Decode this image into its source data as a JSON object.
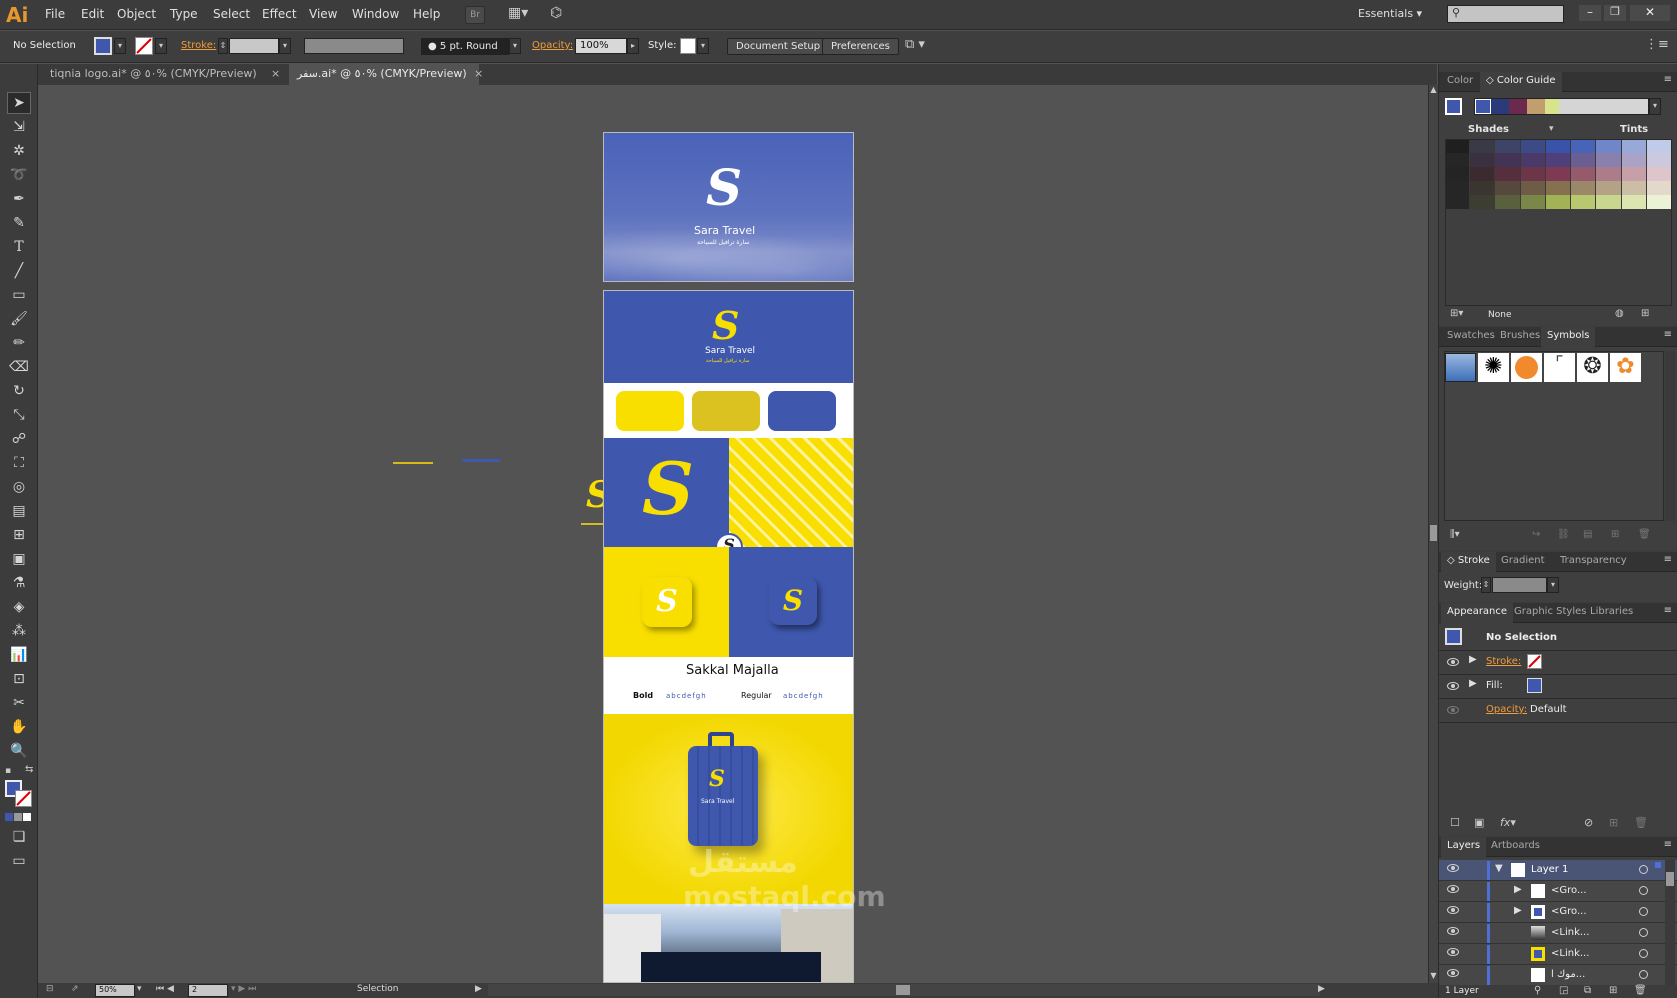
{
  "app": {
    "logo": "Ai",
    "menus": [
      "File",
      "Edit",
      "Object",
      "Type",
      "Select",
      "Effect",
      "View",
      "Window",
      "Help"
    ],
    "bridge_btn": "Br",
    "workspace": "Essentials",
    "search_placeholder": ""
  },
  "control": {
    "selection_label": "No Selection",
    "stroke_label": "Stroke:",
    "brush": "5 pt. Round",
    "opacity_label": "Opacity:",
    "opacity_value": "100%",
    "style_label": "Style:",
    "doc_setup": "Document Setup",
    "preferences": "Preferences"
  },
  "tabs": [
    {
      "label": "tiqnia logo.ai* @ ٥٠% (CMYK/Preview)",
      "close": "×"
    },
    {
      "label": "سفر.ai* @ ٥٠% (CMYK/Preview)",
      "close": "×"
    }
  ],
  "artboards": {
    "brand": "Sara Travel",
    "brand_arabic": "سارة ترافيل للسياحة",
    "font_name": "Sakkal Majalla",
    "bold_label": "Bold",
    "regular_label": "Regular",
    "sample_text": "abcdefgh",
    "colors": [
      "#f8df00",
      "#dcc221",
      "#3f58ae"
    ]
  },
  "status": {
    "zoom": "50%",
    "page": "2",
    "tool": "Selection"
  },
  "color_panel": {
    "tabs": [
      "Color",
      "Color Guide"
    ],
    "shades": "Shades",
    "tints": "Tints",
    "none": "None",
    "rows": [
      [
        "#1f1f1f",
        "#3a3a46",
        "#3e4466",
        "#3c4a86",
        "#3953a8",
        "#4864b9",
        "#6f86c9",
        "#97a8d9",
        "#bfcbe9"
      ],
      [
        "#262626",
        "#3a3040",
        "#433456",
        "#4a3a6a",
        "#4f3f7a",
        "#6a5e93",
        "#8a80ad",
        "#aaa3c6",
        "#ccc8de"
      ],
      [
        "#242424",
        "#3b2a30",
        "#55303c",
        "#6d3648",
        "#7d3a52",
        "#955a6c",
        "#ad7c8a",
        "#c69fa9",
        "#dec4cb"
      ],
      [
        "#262626",
        "#3b3530",
        "#56483c",
        "#6f5c48",
        "#85704f",
        "#9b8868",
        "#b3a285",
        "#cbbda6",
        "#e2d9cb"
      ],
      [
        "#262626",
        "#3b3e31",
        "#58603d",
        "#7b8649",
        "#a1b355",
        "#b7c86f",
        "#c9d78e",
        "#dae5b0",
        "#ebf2d6"
      ]
    ]
  },
  "symbols_panel": {
    "tabs": [
      "Swatches",
      "Brushes",
      "Symbols"
    ]
  },
  "stroke_panel": {
    "tabs": [
      "Stroke",
      "Gradient",
      "Transparency"
    ],
    "weight_label": "Weight:"
  },
  "appearance_panel": {
    "tabs": [
      "Appearance",
      "Graphic Styles",
      "Libraries"
    ],
    "title": "No Selection",
    "stroke_label": "Stroke:",
    "fill_label": "Fill:",
    "opacity_label": "Opacity:",
    "opacity_value": "Default"
  },
  "layers_panel": {
    "tabs": [
      "Layers",
      "Artboards"
    ],
    "rows": [
      "Layer 1",
      "<Gro...",
      "<Gro...",
      "<Link...",
      "<Link...",
      "موك ا..."
    ],
    "footer": "1 Layer"
  },
  "watermark": "mostaql.com"
}
